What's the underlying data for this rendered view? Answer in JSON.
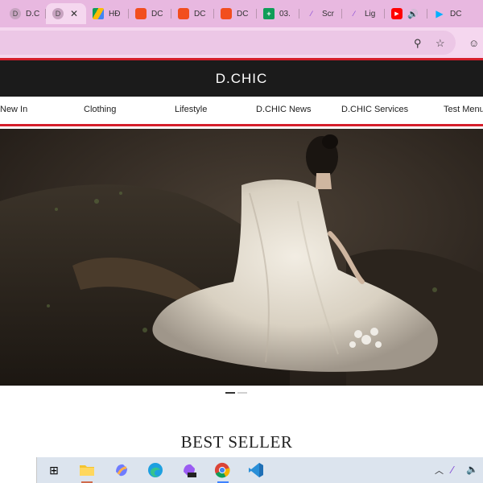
{
  "browser": {
    "tabs": [
      {
        "label": "D.C",
        "icon": "dchic-icon",
        "active": false
      },
      {
        "label": "",
        "icon": "dchic-icon",
        "active": true
      },
      {
        "label": "HĐ",
        "icon": "drive-icon",
        "active": false
      },
      {
        "label": "DC",
        "icon": "figma-icon",
        "active": false
      },
      {
        "label": "DC",
        "icon": "figma-icon",
        "active": false
      },
      {
        "label": "DC",
        "icon": "figma-icon",
        "active": false
      },
      {
        "label": "03.",
        "icon": "sheets-icon",
        "active": false
      },
      {
        "label": "Scr",
        "icon": "pen-icon",
        "active": false
      },
      {
        "label": "Lig",
        "icon": "pen-icon",
        "active": false
      },
      {
        "label": "",
        "icon": "youtube-icon",
        "active": false
      },
      {
        "label": "DC",
        "icon": "play-icon",
        "active": false
      }
    ]
  },
  "site": {
    "logo": "D.CHIC",
    "nav": [
      "New In",
      "Clothing",
      "Lifestyle",
      "D.CHIC News",
      "D.CHIC Services",
      "Test Menu"
    ],
    "best_seller": "BEST SELLER"
  },
  "colors": {
    "accent_red": "#d51e2b",
    "header_bg": "#1b1b1b",
    "tabbar": "#e8b8e0"
  }
}
